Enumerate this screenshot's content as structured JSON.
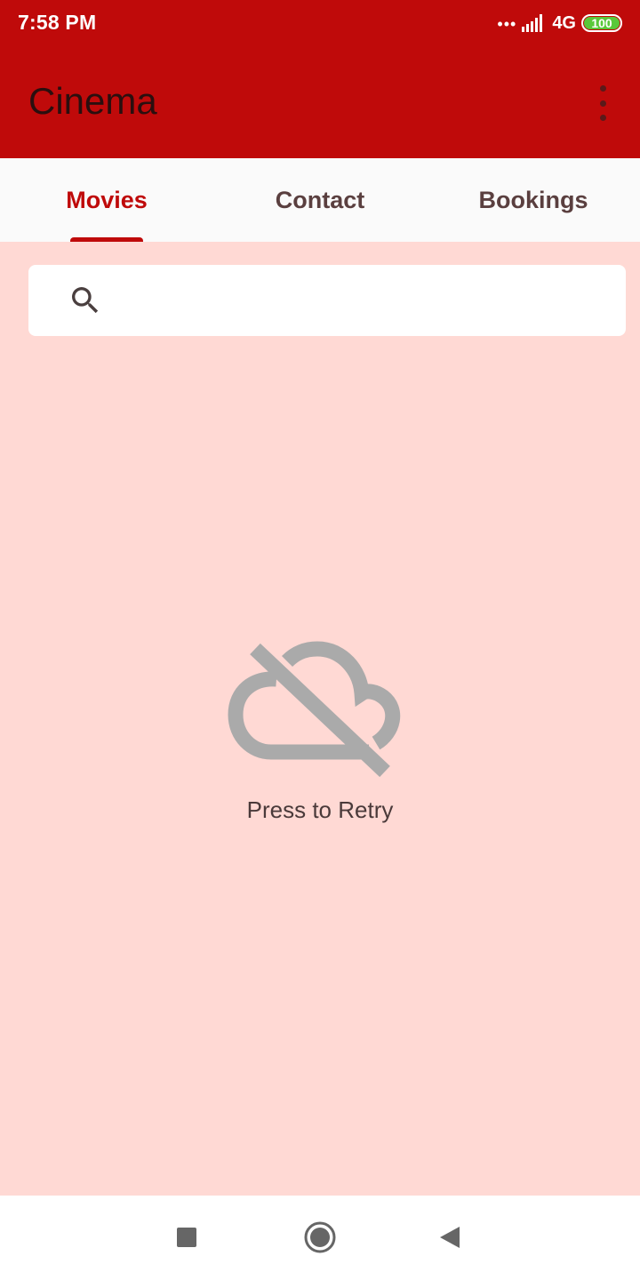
{
  "status_bar": {
    "time": "7:58 PM",
    "dots": "•••",
    "network": "4G",
    "battery": "100",
    "battery_color": "#5ac83a"
  },
  "app_bar": {
    "title": "Cinema",
    "menu_icon": "more-vert-icon"
  },
  "tabs": [
    {
      "label": "Movies",
      "active": true
    },
    {
      "label": "Contact",
      "active": false
    },
    {
      "label": "Bookings",
      "active": false
    }
  ],
  "search": {
    "placeholder": "",
    "value": "",
    "icon": "search-icon"
  },
  "error_state": {
    "icon": "cloud-off-icon",
    "message": "Press to Retry"
  },
  "nav_bar": {
    "icons": [
      "recents-square-icon",
      "home-circle-icon",
      "back-triangle-icon"
    ]
  },
  "colors": {
    "primary": "#bf0a0a",
    "background": "#ffd9d4",
    "tab_bar": "#fafafa",
    "icon_gray": "#aaaaaa"
  }
}
